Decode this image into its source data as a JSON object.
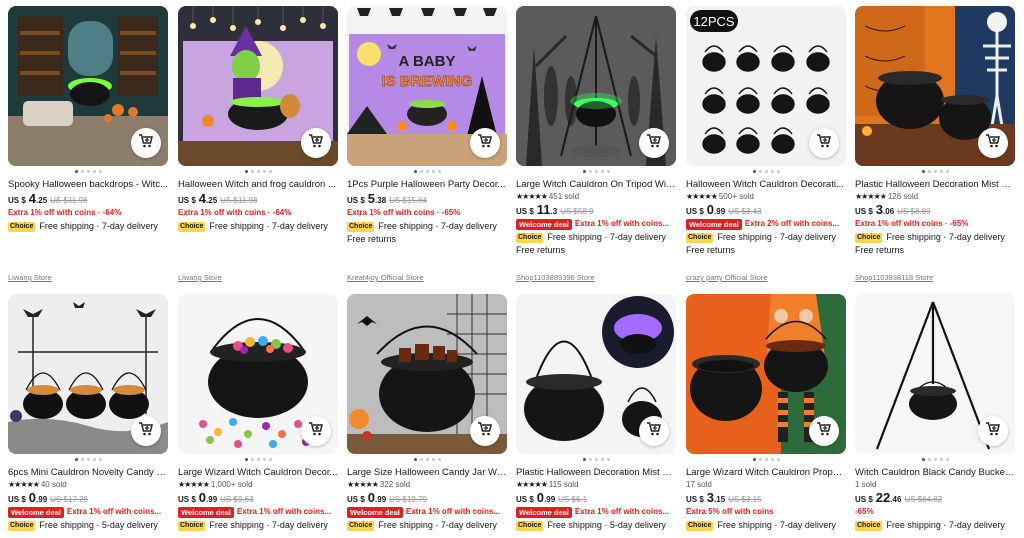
{
  "products": [
    {
      "title": "Spooky Halloween backdrops - Witc...",
      "rating_stars": "",
      "sold": "",
      "currency": "US $",
      "price_int": "4",
      "price_dec": ".25",
      "old_price": "US $11.98",
      "welcome": "",
      "promo": "Extra 1% off with coins · -64%",
      "shipping": "Free shipping · 7-day delivery",
      "free_returns": "",
      "store": "Liwang Store",
      "image_theme": "haunted-room-cauldron"
    },
    {
      "title": "Halloween Witch and frog cauldron ...",
      "rating_stars": "",
      "sold": "",
      "currency": "US $",
      "price_int": "4",
      "price_dec": ".25",
      "old_price": "US $11.98",
      "welcome": "",
      "promo": "Extra 1% off with coins · -64%",
      "shipping": "Free shipping · 7-day delivery",
      "free_returns": "",
      "store": "Liwang Store",
      "image_theme": "witch-cauldron-backdrop"
    },
    {
      "title": "1Pcs Purple Halloween Party Decor...",
      "rating_stars": "",
      "sold": "",
      "currency": "US $",
      "price_int": "5",
      "price_dec": ".38",
      "old_price": "US $15.64",
      "welcome": "",
      "promo": "Extra 1% off with coins · -65%",
      "shipping": "Free shipping · 7-day delivery",
      "free_returns": "Free returns",
      "store": "Kreat4joy Official Store",
      "image_theme": "baby-is-brewing-banner",
      "image_text": [
        "A BABY",
        "IS BREWING"
      ]
    },
    {
      "title": "Large Witch Cauldron On Tripod Wit...",
      "rating_stars": "★★★★★",
      "sold": "451 sold",
      "currency": "US $",
      "price_int": "11",
      "price_dec": ".3",
      "old_price": "US $58.9",
      "welcome": "Welcome deal",
      "promo": "Extra 1% off with coins...",
      "shipping": "Free shipping · 7-day delivery",
      "free_returns": "Free returns",
      "store": "Shop1103889396 Store",
      "image_theme": "green-glow-tripod-cauldron"
    },
    {
      "title": "Halloween Witch Cauldron Decorati...",
      "rating_stars": "★★★★★",
      "sold": "500+ sold",
      "currency": "US $",
      "price_int": "0",
      "price_dec": ".99",
      "old_price": "US $3.43",
      "welcome": "Welcome deal",
      "promo": "Extra 2% off with coins...",
      "shipping": "Free shipping · 7-day delivery",
      "free_returns": "Free returns",
      "store": "crazy party Official Store",
      "image_theme": "twelve-mini-cauldrons",
      "image_text": [
        "12PCS"
      ]
    },
    {
      "title": "Plastic Halloween Decoration Mist S...",
      "rating_stars": "★★★★★",
      "sold": "126 sold",
      "currency": "US $",
      "price_int": "3",
      "price_dec": ".06",
      "old_price": "US $8.89",
      "welcome": "",
      "promo": "Extra 1% off with coins · -65%",
      "shipping": "Free shipping · 7-day delivery",
      "free_returns": "Free returns",
      "store": "Shop1103938118 Store",
      "image_theme": "two-cauldrons-skeleton"
    },
    {
      "title": "6pcs Mini Cauldron Novelty Candy K...",
      "rating_stars": "★★★★★",
      "sold": "40 sold",
      "currency": "US $",
      "price_int": "0",
      "price_dec": ".99",
      "old_price": "US $17.28",
      "welcome": "Welcome deal",
      "promo": "Extra 1% off with coins...",
      "shipping": "Free shipping · 5-day delivery",
      "free_returns": "",
      "store": "",
      "image_theme": "mini-candy-cauldrons"
    },
    {
      "title": "Large Wizard Witch Cauldron Decor...",
      "rating_stars": "★★★★★",
      "sold": "1,000+ sold",
      "currency": "US $",
      "price_int": "0",
      "price_dec": ".99",
      "old_price": "US $9.63",
      "welcome": "Welcome deal",
      "promo": "Extra 1% off with coins...",
      "shipping": "Free shipping · 7-day delivery",
      "free_returns": "",
      "store": "",
      "image_theme": "cauldron-with-candy"
    },
    {
      "title": "Large Size Halloween Candy Jar Wiz...",
      "rating_stars": "★★★★★",
      "sold": "322 sold",
      "currency": "US $",
      "price_int": "0",
      "price_dec": ".99",
      "old_price": "US $19.79",
      "welcome": "Welcome deal",
      "promo": "Extra 1% off with coins...",
      "shipping": "Free shipping · 7-day delivery",
      "free_returns": "",
      "store": "",
      "image_theme": "candy-jar-cauldron"
    },
    {
      "title": "Plastic Halloween Decoration Mist S...",
      "rating_stars": "★★★★★",
      "sold": "115 sold",
      "currency": "US $",
      "price_int": "0",
      "price_dec": ".99",
      "old_price": "US $6.1",
      "welcome": "Welcome deal",
      "promo": "Extra 1% off with coins...",
      "shipping": "Free shipping · 5-day delivery",
      "free_returns": "",
      "store": "",
      "image_theme": "mist-cauldron-purple"
    },
    {
      "title": "Large Wizard Witch Cauldron Props ...",
      "rating_stars": "",
      "sold": "17 sold",
      "currency": "US $",
      "price_int": "3",
      "price_dec": ".15",
      "old_price": "US $3.15",
      "welcome": "",
      "promo": "Extra 5% off with coins",
      "shipping": "Free shipping · 7-day delivery",
      "free_returns": "",
      "store": "",
      "image_theme": "cauldron-prop-kid"
    },
    {
      "title": "Witch Cauldron Black Candy Bucket...",
      "rating_stars": "",
      "sold": "1 sold",
      "currency": "US $",
      "price_int": "22",
      "price_dec": ".46",
      "old_price": "US $64.82",
      "welcome": "",
      "promo": "-65%",
      "shipping": "Free shipping · 7-day delivery",
      "free_returns": "",
      "store": "",
      "image_theme": "tripod-black-cauldron"
    }
  ]
}
